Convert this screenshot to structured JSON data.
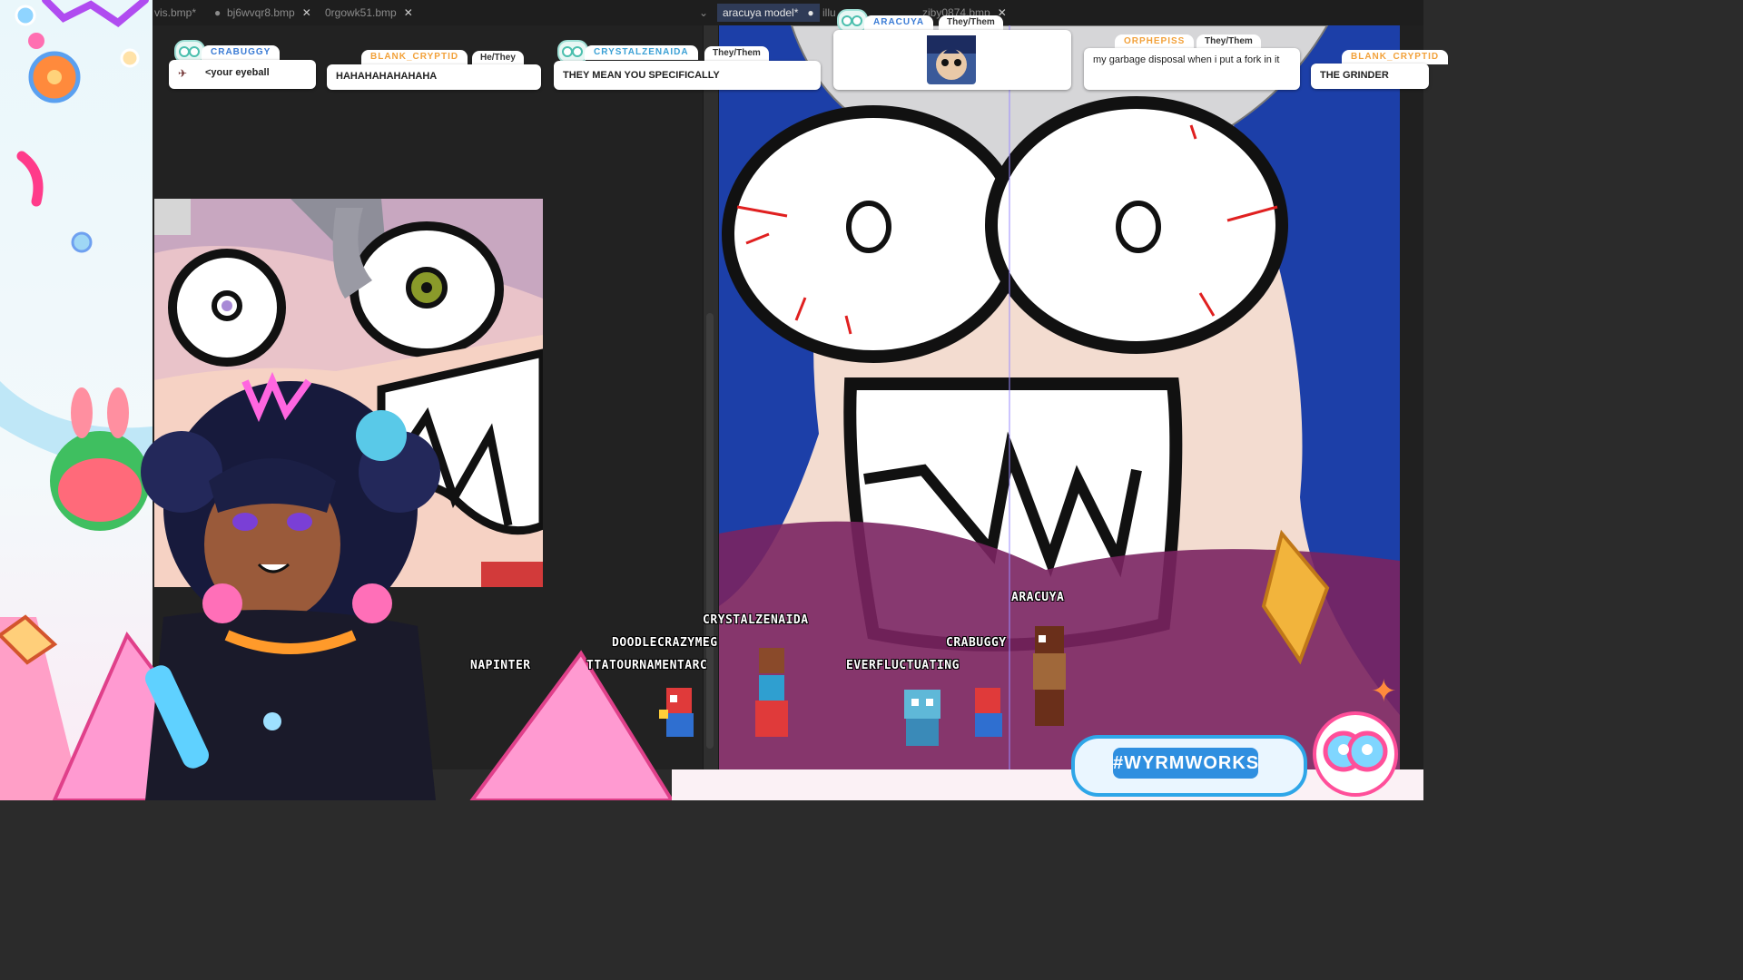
{
  "tabs": [
    {
      "label": "vis.bmp*",
      "modified": true,
      "closable": false
    },
    {
      "label": "bj6wvqr8.bmp",
      "modified": false,
      "closable": true
    },
    {
      "label": "0rgowk51.bmp",
      "modified": false,
      "closable": true
    },
    {
      "label": "aracuya model*",
      "modified": true,
      "closable": false,
      "active": true
    },
    {
      "label": "illu",
      "modified": false,
      "closable": false
    },
    {
      "label": "zjby0874.bmp",
      "modified": false,
      "closable": true
    }
  ],
  "chat": [
    {
      "username": "CRABUGGY",
      "pronouns": "",
      "message": "<your eyeball",
      "color": "#3a7bd5"
    },
    {
      "username": "BLANK_CRYPTID",
      "pronouns": "He/They",
      "message": "HAHAHAHAHAHAHA",
      "color": "#f2a13a"
    },
    {
      "username": "CRYSTALZENAIDA",
      "pronouns": "They/Them",
      "message": "THEY MEAN YOU SPECIFICALLY",
      "color": "#3aa0d5"
    },
    {
      "username": "ARACUYA",
      "pronouns": "They/Them",
      "message": "",
      "color": "#3a7bd5"
    },
    {
      "username": "ORPHEPISS",
      "pronouns": "They/Them",
      "message": "my garbage disposal when i put a fork in it",
      "color": "#f2a13a"
    },
    {
      "username": "BLANK_CRYPTID",
      "pronouns": "",
      "message": "THE GRINDER",
      "color": "#f2a13a"
    }
  ],
  "viewers": [
    "CRYSTALZENAIDA",
    "DOODLECRAZYMEG",
    "NAPINTER",
    "TTATOURNAMENTARC",
    "EVERFLUCTUATING",
    "CRABUGGY",
    "ARACUYA"
  ],
  "hashtag": "#WYRMWORKS",
  "colors": {
    "accent": "#2fa6e8",
    "pink": "#ff4f9a",
    "hair_blue": "#1c3fa8",
    "chat_teal": "#4cbfae"
  }
}
